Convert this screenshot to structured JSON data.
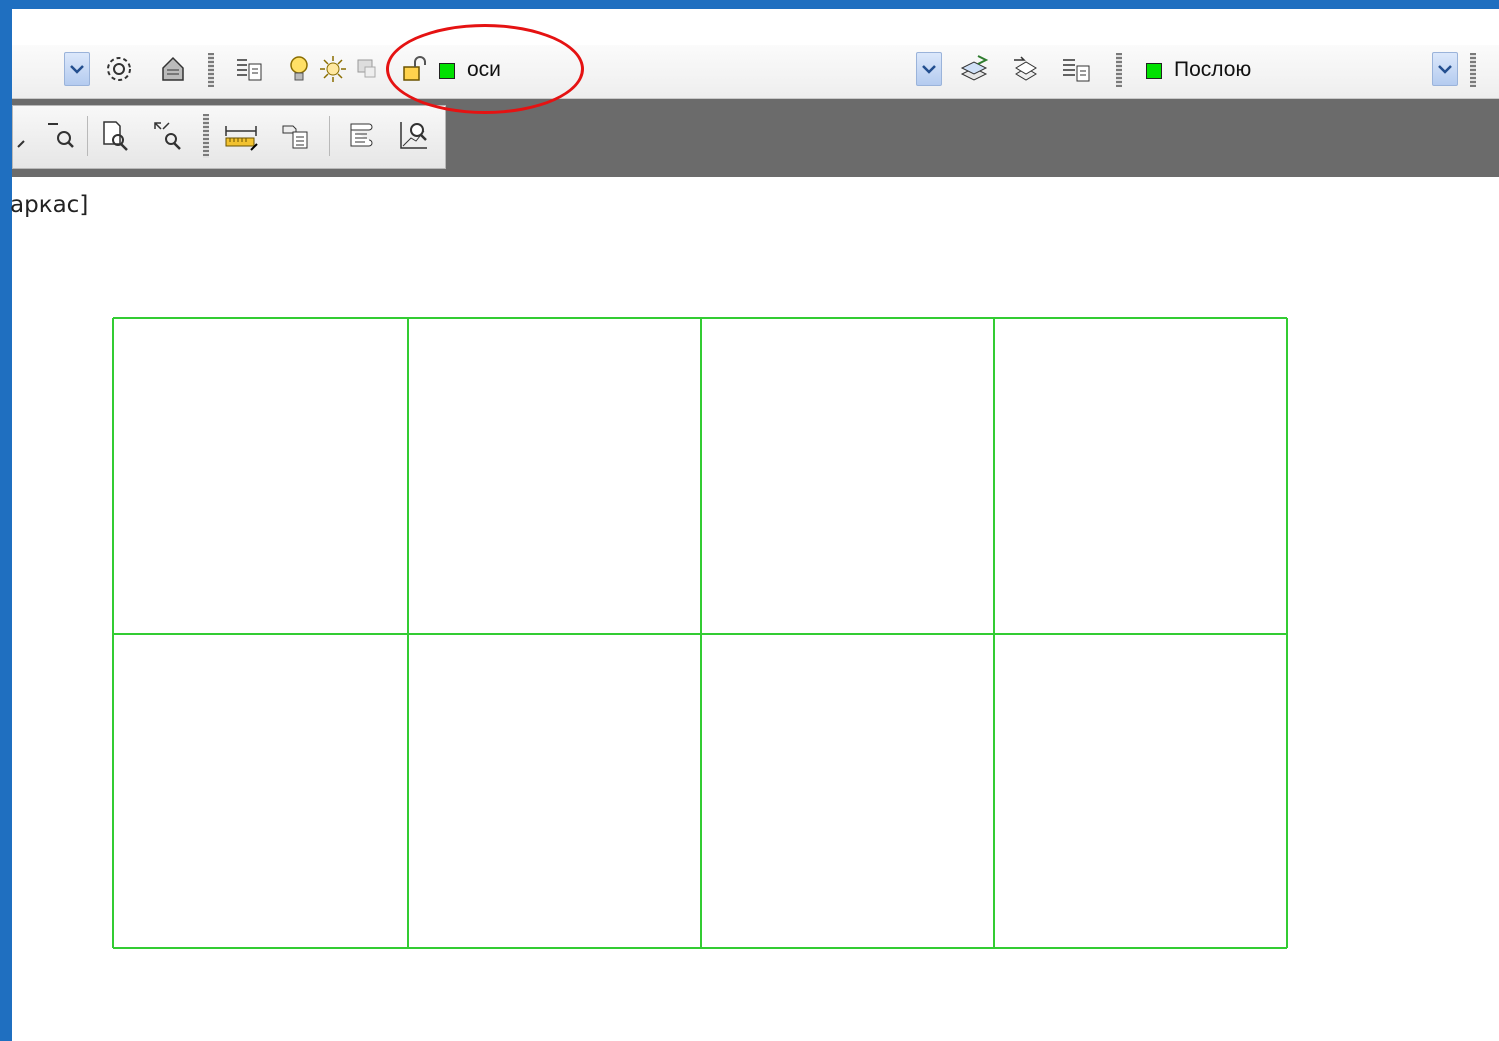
{
  "toolbar": {
    "layer_name": "оси",
    "layer_color": "#00e000",
    "color_control": "Послою",
    "color_swatch": "#00e000",
    "icons_left": [
      "dropdown-arrow",
      "layer-settings",
      "layer-states",
      "layer-properties",
      "lightbulb-on",
      "sun-freeze",
      "layer-lock-plot",
      "padlock-unlocked"
    ],
    "icons_mid": [
      "dropdown-arrow",
      "make-current-layer",
      "layer-previous",
      "layer-properties-manager"
    ],
    "icons_view": [
      "zoom-realtime",
      "zoom-window",
      "zoom-extents",
      "distance-measure",
      "quick-properties",
      "list-properties",
      "area-query"
    ]
  },
  "viewport": {
    "label": "аркас]"
  },
  "accent_colors": {
    "frame": "#1f6fc0",
    "highlight": "#e51212",
    "grid_lines": "#33cc33"
  },
  "drawing": {
    "layer": "оси",
    "columns": 4,
    "rows": 2
  }
}
